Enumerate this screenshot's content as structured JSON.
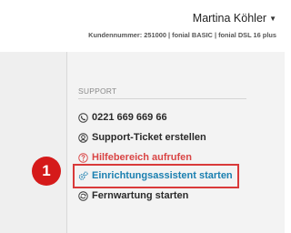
{
  "header": {
    "user_name": "Martina Köhler",
    "account_info": "Kundennummer: 251000 | fonial BASIC | fonial DSL 16 plus"
  },
  "support": {
    "title": "SUPPORT",
    "items": [
      {
        "label": "0221 669 669 66",
        "icon": "phone-icon"
      },
      {
        "label": "Support-Ticket erstellen",
        "icon": "support-headset-icon"
      },
      {
        "label": "Hilfebereich aufrufen",
        "icon": "help-icon"
      },
      {
        "label": "Einrichtungsassistent starten",
        "icon": "gears-icon"
      },
      {
        "label": "Fernwartung starten",
        "icon": "remote-sync-icon"
      }
    ]
  },
  "annotation": {
    "step_number": "1"
  },
  "colors": {
    "help": "#d94545",
    "wizard": "#1a7fb0",
    "highlight": "#d93a3a",
    "badge": "#d51a1a"
  }
}
